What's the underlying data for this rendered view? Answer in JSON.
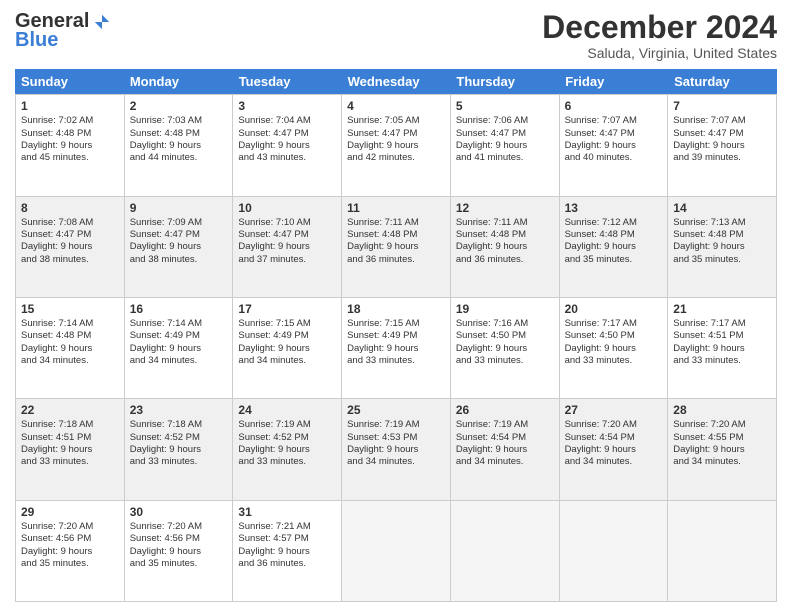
{
  "logo": {
    "general": "General",
    "blue": "Blue"
  },
  "title": "December 2024",
  "location": "Saluda, Virginia, United States",
  "header_days": [
    "Sunday",
    "Monday",
    "Tuesday",
    "Wednesday",
    "Thursday",
    "Friday",
    "Saturday"
  ],
  "weeks": [
    [
      {
        "day": "1",
        "lines": [
          "Sunrise: 7:02 AM",
          "Sunset: 4:48 PM",
          "Daylight: 9 hours",
          "and 45 minutes."
        ],
        "empty": false,
        "shaded": false
      },
      {
        "day": "2",
        "lines": [
          "Sunrise: 7:03 AM",
          "Sunset: 4:48 PM",
          "Daylight: 9 hours",
          "and 44 minutes."
        ],
        "empty": false,
        "shaded": false
      },
      {
        "day": "3",
        "lines": [
          "Sunrise: 7:04 AM",
          "Sunset: 4:47 PM",
          "Daylight: 9 hours",
          "and 43 minutes."
        ],
        "empty": false,
        "shaded": false
      },
      {
        "day": "4",
        "lines": [
          "Sunrise: 7:05 AM",
          "Sunset: 4:47 PM",
          "Daylight: 9 hours",
          "and 42 minutes."
        ],
        "empty": false,
        "shaded": false
      },
      {
        "day": "5",
        "lines": [
          "Sunrise: 7:06 AM",
          "Sunset: 4:47 PM",
          "Daylight: 9 hours",
          "and 41 minutes."
        ],
        "empty": false,
        "shaded": false
      },
      {
        "day": "6",
        "lines": [
          "Sunrise: 7:07 AM",
          "Sunset: 4:47 PM",
          "Daylight: 9 hours",
          "and 40 minutes."
        ],
        "empty": false,
        "shaded": false
      },
      {
        "day": "7",
        "lines": [
          "Sunrise: 7:07 AM",
          "Sunset: 4:47 PM",
          "Daylight: 9 hours",
          "and 39 minutes."
        ],
        "empty": false,
        "shaded": false
      }
    ],
    [
      {
        "day": "8",
        "lines": [
          "Sunrise: 7:08 AM",
          "Sunset: 4:47 PM",
          "Daylight: 9 hours",
          "and 38 minutes."
        ],
        "empty": false,
        "shaded": true
      },
      {
        "day": "9",
        "lines": [
          "Sunrise: 7:09 AM",
          "Sunset: 4:47 PM",
          "Daylight: 9 hours",
          "and 38 minutes."
        ],
        "empty": false,
        "shaded": true
      },
      {
        "day": "10",
        "lines": [
          "Sunrise: 7:10 AM",
          "Sunset: 4:47 PM",
          "Daylight: 9 hours",
          "and 37 minutes."
        ],
        "empty": false,
        "shaded": true
      },
      {
        "day": "11",
        "lines": [
          "Sunrise: 7:11 AM",
          "Sunset: 4:48 PM",
          "Daylight: 9 hours",
          "and 36 minutes."
        ],
        "empty": false,
        "shaded": true
      },
      {
        "day": "12",
        "lines": [
          "Sunrise: 7:11 AM",
          "Sunset: 4:48 PM",
          "Daylight: 9 hours",
          "and 36 minutes."
        ],
        "empty": false,
        "shaded": true
      },
      {
        "day": "13",
        "lines": [
          "Sunrise: 7:12 AM",
          "Sunset: 4:48 PM",
          "Daylight: 9 hours",
          "and 35 minutes."
        ],
        "empty": false,
        "shaded": true
      },
      {
        "day": "14",
        "lines": [
          "Sunrise: 7:13 AM",
          "Sunset: 4:48 PM",
          "Daylight: 9 hours",
          "and 35 minutes."
        ],
        "empty": false,
        "shaded": true
      }
    ],
    [
      {
        "day": "15",
        "lines": [
          "Sunrise: 7:14 AM",
          "Sunset: 4:48 PM",
          "Daylight: 9 hours",
          "and 34 minutes."
        ],
        "empty": false,
        "shaded": false
      },
      {
        "day": "16",
        "lines": [
          "Sunrise: 7:14 AM",
          "Sunset: 4:49 PM",
          "Daylight: 9 hours",
          "and 34 minutes."
        ],
        "empty": false,
        "shaded": false
      },
      {
        "day": "17",
        "lines": [
          "Sunrise: 7:15 AM",
          "Sunset: 4:49 PM",
          "Daylight: 9 hours",
          "and 34 minutes."
        ],
        "empty": false,
        "shaded": false
      },
      {
        "day": "18",
        "lines": [
          "Sunrise: 7:15 AM",
          "Sunset: 4:49 PM",
          "Daylight: 9 hours",
          "and 33 minutes."
        ],
        "empty": false,
        "shaded": false
      },
      {
        "day": "19",
        "lines": [
          "Sunrise: 7:16 AM",
          "Sunset: 4:50 PM",
          "Daylight: 9 hours",
          "and 33 minutes."
        ],
        "empty": false,
        "shaded": false
      },
      {
        "day": "20",
        "lines": [
          "Sunrise: 7:17 AM",
          "Sunset: 4:50 PM",
          "Daylight: 9 hours",
          "and 33 minutes."
        ],
        "empty": false,
        "shaded": false
      },
      {
        "day": "21",
        "lines": [
          "Sunrise: 7:17 AM",
          "Sunset: 4:51 PM",
          "Daylight: 9 hours",
          "and 33 minutes."
        ],
        "empty": false,
        "shaded": false
      }
    ],
    [
      {
        "day": "22",
        "lines": [
          "Sunrise: 7:18 AM",
          "Sunset: 4:51 PM",
          "Daylight: 9 hours",
          "and 33 minutes."
        ],
        "empty": false,
        "shaded": true
      },
      {
        "day": "23",
        "lines": [
          "Sunrise: 7:18 AM",
          "Sunset: 4:52 PM",
          "Daylight: 9 hours",
          "and 33 minutes."
        ],
        "empty": false,
        "shaded": true
      },
      {
        "day": "24",
        "lines": [
          "Sunrise: 7:19 AM",
          "Sunset: 4:52 PM",
          "Daylight: 9 hours",
          "and 33 minutes."
        ],
        "empty": false,
        "shaded": true
      },
      {
        "day": "25",
        "lines": [
          "Sunrise: 7:19 AM",
          "Sunset: 4:53 PM",
          "Daylight: 9 hours",
          "and 34 minutes."
        ],
        "empty": false,
        "shaded": true
      },
      {
        "day": "26",
        "lines": [
          "Sunrise: 7:19 AM",
          "Sunset: 4:54 PM",
          "Daylight: 9 hours",
          "and 34 minutes."
        ],
        "empty": false,
        "shaded": true
      },
      {
        "day": "27",
        "lines": [
          "Sunrise: 7:20 AM",
          "Sunset: 4:54 PM",
          "Daylight: 9 hours",
          "and 34 minutes."
        ],
        "empty": false,
        "shaded": true
      },
      {
        "day": "28",
        "lines": [
          "Sunrise: 7:20 AM",
          "Sunset: 4:55 PM",
          "Daylight: 9 hours",
          "and 34 minutes."
        ],
        "empty": false,
        "shaded": true
      }
    ],
    [
      {
        "day": "29",
        "lines": [
          "Sunrise: 7:20 AM",
          "Sunset: 4:56 PM",
          "Daylight: 9 hours",
          "and 35 minutes."
        ],
        "empty": false,
        "shaded": false
      },
      {
        "day": "30",
        "lines": [
          "Sunrise: 7:20 AM",
          "Sunset: 4:56 PM",
          "Daylight: 9 hours",
          "and 35 minutes."
        ],
        "empty": false,
        "shaded": false
      },
      {
        "day": "31",
        "lines": [
          "Sunrise: 7:21 AM",
          "Sunset: 4:57 PM",
          "Daylight: 9 hours",
          "and 36 minutes."
        ],
        "empty": false,
        "shaded": false
      },
      {
        "day": "",
        "lines": [],
        "empty": true,
        "shaded": false
      },
      {
        "day": "",
        "lines": [],
        "empty": true,
        "shaded": false
      },
      {
        "day": "",
        "lines": [],
        "empty": true,
        "shaded": false
      },
      {
        "day": "",
        "lines": [],
        "empty": true,
        "shaded": false
      }
    ]
  ]
}
